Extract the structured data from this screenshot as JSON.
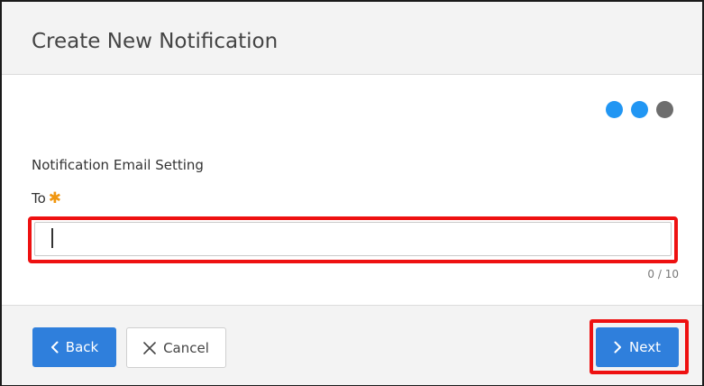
{
  "dialog": {
    "title": "Create New Notification"
  },
  "steps": {
    "dots": [
      {
        "state": "completed",
        "color": "#2196f3"
      },
      {
        "state": "current",
        "color": "#2196f3"
      },
      {
        "state": "pending",
        "color": "#6d6d6d"
      }
    ]
  },
  "form": {
    "section_title": "Notification Email Setting",
    "to_label": "To",
    "required_marker": "✱",
    "to_value": "",
    "char_count": "0 / 10"
  },
  "footer": {
    "back_label": "Back",
    "back_icon": "chevron-left-icon",
    "cancel_label": "Cancel",
    "cancel_icon": "close-icon",
    "next_label": "Next",
    "next_icon": "chevron-right-icon"
  },
  "colors": {
    "primary": "#2f7fdc",
    "highlight": "#ee1111",
    "required": "#f0960f"
  }
}
